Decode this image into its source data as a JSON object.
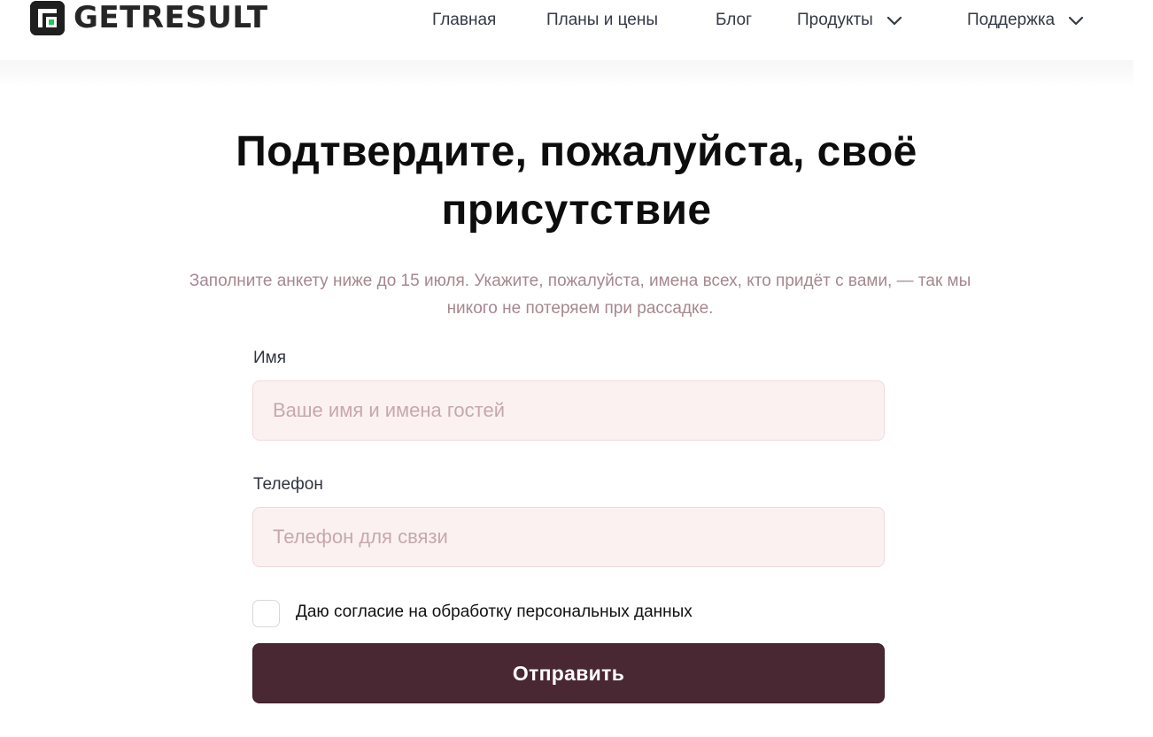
{
  "header": {
    "logo_text": "GETRESULT",
    "nav": [
      {
        "label": "Главная",
        "icon": null
      },
      {
        "label": "Планы и цены",
        "icon": null
      },
      {
        "label": "Блог",
        "icon": null
      },
      {
        "label": "Продукты",
        "icon": "chevron-down-icon"
      },
      {
        "label": "Поддержка",
        "icon": "chevron-down-icon"
      }
    ]
  },
  "main": {
    "title_line1": "Подтвердите, пожалуйста, своё",
    "title_line2": "присутствие",
    "subtitle_line1": "Заполните анкету ниже до 15 июля. Укажите, пожалуйста, имена всех, кто придёт с вами, — так мы",
    "subtitle_line2": "никого не потеряем при рассадке."
  },
  "form": {
    "name_label": "Имя",
    "name_placeholder": "Ваше имя и имена гостей",
    "name_value": "",
    "phone_label": "Телефон",
    "phone_placeholder": "Телефон для связи",
    "phone_value": "",
    "consent_label": "Даю согласие на обработку персональных данных",
    "consent_checked": false,
    "submit_label": "Отправить"
  },
  "colors": {
    "accent": "#4a2833",
    "logo_accent": "#22c55e",
    "input_bg": "#fbf1f1",
    "subtitle": "#a6878f"
  }
}
